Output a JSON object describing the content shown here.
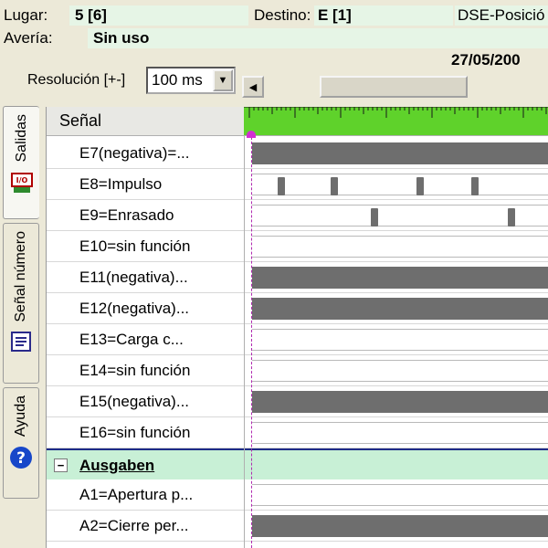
{
  "header": {
    "lugar_label": "Lugar:",
    "lugar_value": "5 [6]",
    "destino_label": "Destino:",
    "destino_value": "E [1]",
    "dse_label": "DSE-Posició",
    "averia_label": "Avería:",
    "averia_value": "Sin uso"
  },
  "toolbar": {
    "resolution_label": "Resolución [+-]",
    "resolution_value": "100 ms",
    "date": "27/05/200"
  },
  "tabs": [
    {
      "label": "Salidas",
      "icon": "io-icon",
      "active": true
    },
    {
      "label": "Señal número",
      "icon": "list-icon",
      "active": false
    },
    {
      "label": "Ayuda",
      "icon": "help-icon",
      "active": false
    }
  ],
  "table": {
    "column_header": "Señal",
    "rows": [
      {
        "name": "E7(negativa)=...",
        "state": "high"
      },
      {
        "name": "E8=Impulso",
        "state": "pulses"
      },
      {
        "name": "E9=Enrasado",
        "state": "pulses"
      },
      {
        "name": "E10=sin función",
        "state": "low"
      },
      {
        "name": "E11(negativa)...",
        "state": "high"
      },
      {
        "name": "E12(negativa)...",
        "state": "high"
      },
      {
        "name": "E13=Carga c...",
        "state": "low"
      },
      {
        "name": "E14=sin función",
        "state": "low"
      },
      {
        "name": "E15(negativa)...",
        "state": "high"
      },
      {
        "name": "E16=sin función",
        "state": "low"
      }
    ],
    "section": {
      "toggle": "−",
      "title": "Ausgaben"
    },
    "outputs": [
      {
        "name": "A1=Apertura p...",
        "state": "low"
      },
      {
        "name": "A2=Cierre per...",
        "state": "high"
      }
    ]
  },
  "colors": {
    "ruler": "#5fd22b",
    "signal_high": "#6e6e6e",
    "section_bg": "#c8f0d6",
    "cursor": "#d22fd2"
  }
}
